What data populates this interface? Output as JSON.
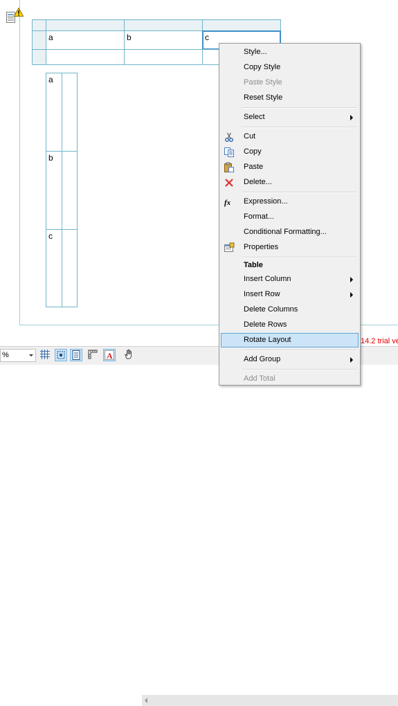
{
  "horizontal_table": {
    "cells": [
      "a",
      "b",
      "c"
    ]
  },
  "vertical_table": {
    "cells": [
      "a",
      "b",
      "c"
    ]
  },
  "context_menu": {
    "items": [
      {
        "label": "Style...",
        "enabled": true
      },
      {
        "label": "Copy Style",
        "enabled": true
      },
      {
        "label": "Paste Style",
        "enabled": false
      },
      {
        "label": "Reset Style",
        "enabled": true
      },
      {
        "label": "Select",
        "enabled": true,
        "submenu": true
      },
      {
        "label": "Cut",
        "enabled": true,
        "icon": "scissors-icon"
      },
      {
        "label": "Copy",
        "enabled": true,
        "icon": "copy-icon"
      },
      {
        "label": "Paste",
        "enabled": true,
        "icon": "paste-icon"
      },
      {
        "label": "Delete...",
        "enabled": true,
        "icon": "delete-icon"
      },
      {
        "label": "Expression...",
        "enabled": true,
        "icon": "fx-icon"
      },
      {
        "label": "Format...",
        "enabled": true
      },
      {
        "label": "Conditional Formatting...",
        "enabled": true
      },
      {
        "label": "Properties",
        "enabled": true,
        "icon": "properties-icon"
      },
      {
        "label": "Table",
        "enabled": true,
        "section_header": true
      },
      {
        "label": "Insert Column",
        "enabled": true,
        "submenu": true
      },
      {
        "label": "Insert Row",
        "enabled": true,
        "submenu": true
      },
      {
        "label": "Delete Columns",
        "enabled": true
      },
      {
        "label": "Delete Rows",
        "enabled": true
      },
      {
        "label": "Rotate Layout",
        "enabled": true,
        "highlighted": true
      },
      {
        "label": "Add Group",
        "enabled": true,
        "submenu": true
      },
      {
        "label": "Add Total",
        "enabled": false
      }
    ]
  },
  "toolbar": {
    "zoom_value": "%"
  },
  "status": {
    "trial_text": "14.2 trial ve"
  },
  "colors": {
    "table_border": "#6fb5c8",
    "highlight": "#cce4f7",
    "trial_red": "#e00000"
  }
}
